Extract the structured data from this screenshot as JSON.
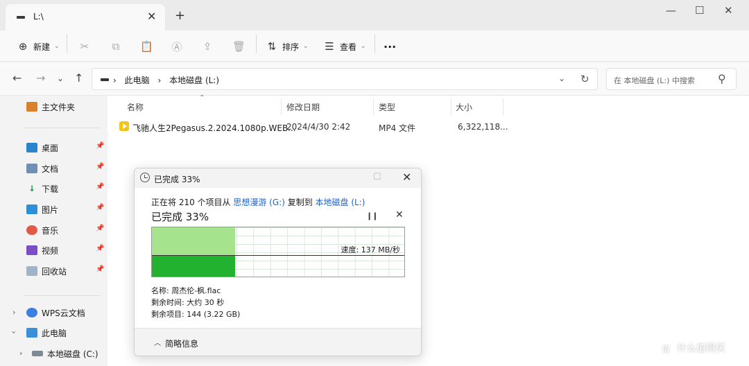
{
  "window": {
    "tab_title": "L:\\",
    "tab_close": "✕",
    "new_tab": "+",
    "minimize": "—",
    "maximize": "☐",
    "close": "✕"
  },
  "toolbar": {
    "new_label": "新建",
    "sort_label": "排序",
    "view_label": "查看",
    "more_label": "···"
  },
  "addressbar": {
    "crumbs": [
      "此电脑",
      "本地磁盘 (L:)"
    ],
    "search_placeholder": "在 本地磁盘 (L:) 中搜索"
  },
  "sidebar": {
    "home": "主文件夹",
    "quick": [
      "桌面",
      "文档",
      "下载",
      "图片",
      "音乐",
      "视频",
      "回收站"
    ],
    "wps": "WPS云文档",
    "thispc": "此电脑",
    "local_c": "本地磁盘 (C:)"
  },
  "columns": [
    "名称",
    "修改日期",
    "类型",
    "大小"
  ],
  "files": [
    {
      "name": "飞驰人生2Pegasus.2.2024.1080p.WEB...",
      "date": "2024/4/30 2:42",
      "type": "MP4 文件",
      "size": "6,322,118..."
    }
  ],
  "dialog": {
    "title": "已完成 33%",
    "line_prefix": "正在将 210 个项目从 ",
    "source": "思想漫游 (G:)",
    "line_mid": " 复制到 ",
    "dest": "本地磁盘 (L:)",
    "percent_label": "已完成 33%",
    "progress": 0.33,
    "speed": "速度: 137 MB/秒",
    "name_line": "名称: 周杰伦-枫.flac",
    "time_line": "剩余时间: 大约 30 秒",
    "items_line": "剩余项目: 144 (3.22 GB)",
    "details_toggle": "简略信息"
  },
  "watermark": {
    "mark": "值",
    "text": "什么值得买"
  }
}
